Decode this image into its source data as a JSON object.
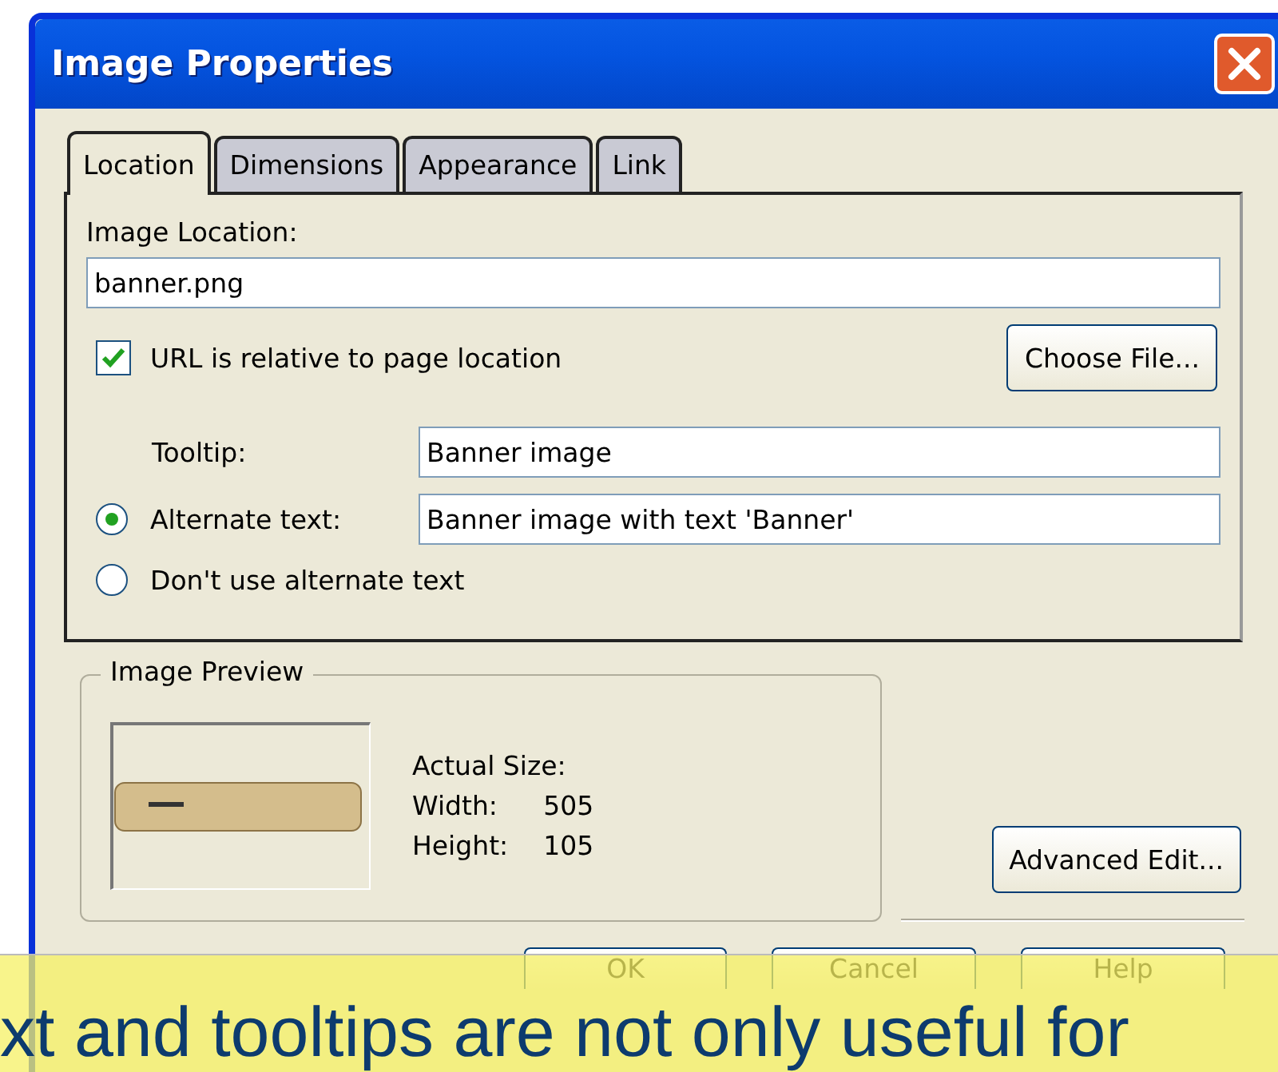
{
  "window": {
    "title": "Image Properties"
  },
  "tabs": [
    {
      "label": "Location",
      "selected": true
    },
    {
      "label": "Dimensions",
      "selected": false
    },
    {
      "label": "Appearance",
      "selected": false
    },
    {
      "label": "Link",
      "selected": false
    }
  ],
  "location": {
    "label": "Image Location:",
    "value": "banner.png",
    "relative": {
      "label": "URL is relative to page location",
      "checked": true
    },
    "choose_button": "Choose File..."
  },
  "tooltip": {
    "label": "Tooltip:",
    "value": "Banner image"
  },
  "alt_options": [
    {
      "kind": "field",
      "label": "Alternate text:",
      "value": "Banner image with text 'Banner'",
      "selected": true
    },
    {
      "kind": "plain",
      "label": "Don't use alternate text",
      "selected": false
    }
  ],
  "preview": {
    "title": "Image Preview",
    "size_label": "Actual Size:",
    "rows": [
      {
        "label": "Width:",
        "value": "505"
      },
      {
        "label": "Height:",
        "value": "105"
      }
    ]
  },
  "advanced_button": "Advanced Edit...",
  "buttons": [
    "OK",
    "Cancel",
    "Help"
  ],
  "caption": "xt and tooltips are not only useful for"
}
